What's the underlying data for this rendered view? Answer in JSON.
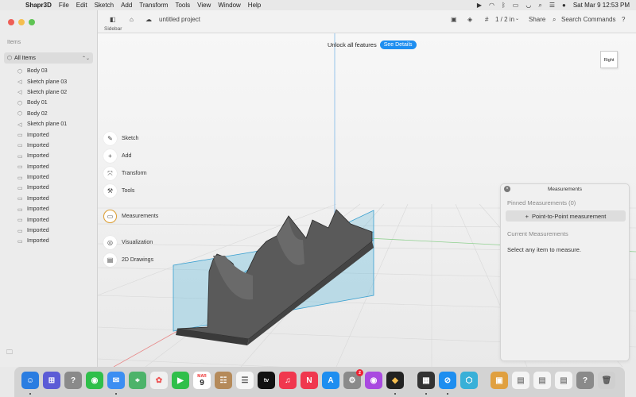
{
  "menubar": {
    "app_name": "Shapr3D",
    "menus": [
      "File",
      "Edit",
      "Sketch",
      "Add",
      "Transform",
      "Tools",
      "View",
      "Window",
      "Help"
    ],
    "datetime": "Sat Mar 9  12:53 PM"
  },
  "sidebar": {
    "items_label": "Items",
    "filter_label": "All Items",
    "tree": [
      {
        "label": "Body 03",
        "icon": "body-icon"
      },
      {
        "label": "Sketch plane 03",
        "icon": "sketch-plane-icon"
      },
      {
        "label": "Sketch plane 02",
        "icon": "sketch-plane-icon"
      },
      {
        "label": "Body 01",
        "icon": "body-icon"
      },
      {
        "label": "Body 02",
        "icon": "body-icon"
      },
      {
        "label": "Sketch plane 01",
        "icon": "sketch-plane-icon"
      },
      {
        "label": "Imported",
        "icon": "folder-icon"
      },
      {
        "label": "Imported",
        "icon": "folder-icon"
      },
      {
        "label": "Imported",
        "icon": "folder-icon"
      },
      {
        "label": "Imported",
        "icon": "folder-icon"
      },
      {
        "label": "Imported",
        "icon": "folder-icon"
      },
      {
        "label": "Imported",
        "icon": "folder-icon"
      },
      {
        "label": "Imported",
        "icon": "folder-icon"
      },
      {
        "label": "Imported",
        "icon": "folder-icon"
      },
      {
        "label": "Imported",
        "icon": "folder-icon"
      },
      {
        "label": "Imported",
        "icon": "folder-icon"
      },
      {
        "label": "Imported",
        "icon": "folder-icon"
      }
    ]
  },
  "toolbar": {
    "sidebar_caption": "Sidebar",
    "project_name": "untitled project",
    "pages": "1 / 2 in",
    "share": "Share",
    "search_commands": "Search Commands"
  },
  "viewport": {
    "unlock_text": "Unlock all features",
    "details_button": "See Details",
    "viewcube_label": "Right",
    "tools": [
      {
        "label": "Sketch",
        "icon": "pencil-icon"
      },
      {
        "label": "Add",
        "icon": "plus-icon"
      },
      {
        "label": "Transform",
        "icon": "transform-icon"
      },
      {
        "label": "Tools",
        "icon": "wrench-icon"
      },
      {
        "label": "Measurements",
        "icon": "ruler-icon"
      },
      {
        "label": "Visualization",
        "icon": "visualization-icon"
      },
      {
        "label": "2D Drawings",
        "icon": "drawing-icon"
      }
    ]
  },
  "measurements": {
    "title": "Measurements",
    "pinned_label": "Pinned Measurements (0)",
    "p2p_button": "Point-to-Point measurement",
    "current_label": "Current Measurements",
    "hint": "Select any item to measure."
  },
  "dock": {
    "calendar_month": "MAR",
    "calendar_day": "9",
    "tv_label": "tv",
    "badge_count": "2"
  }
}
